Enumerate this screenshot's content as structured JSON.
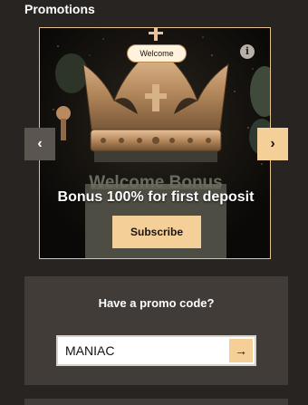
{
  "section": {
    "title": "Promotions"
  },
  "carousel": {
    "badge": "Welcome",
    "art_text": "Welcome Bonus",
    "caption": "Bonus 100% for first deposit",
    "cta_label": "Subscribe",
    "info_icon": "info-icon",
    "prev_icon": "‹",
    "next_icon": "›"
  },
  "promo": {
    "title": "Have a promo code?",
    "value": "MANIAC",
    "submit_icon": "→"
  },
  "colors": {
    "background": "#282421",
    "panel": "#413c38",
    "accent": "#f5cf98",
    "border_accent": "#e6c28e"
  }
}
